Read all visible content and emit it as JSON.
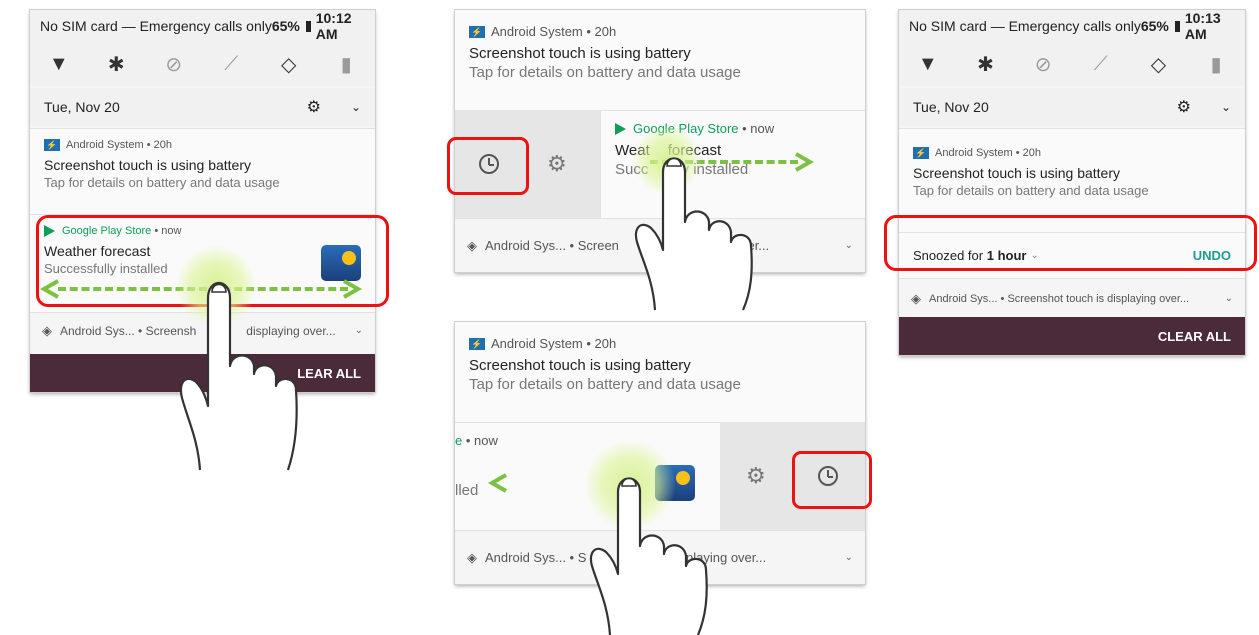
{
  "panel1": {
    "status": {
      "carrier": "No SIM card — Emergency calls only",
      "battery": "65%",
      "time": "10:12 AM"
    },
    "date": "Tue, Nov 20",
    "android_notif": {
      "app": "Android System",
      "age": "20h",
      "title": "Screenshot touch is using battery",
      "subtitle": "Tap for details on battery and data usage"
    },
    "play_notif": {
      "app": "Google Play Store",
      "age": "now",
      "title": "Weather forecast",
      "subtitle": "Successfully installed"
    },
    "collapsed": {
      "app": "Android Sys...",
      "text": "Screensh",
      "text2": "displaying over..."
    },
    "clear_all": "LEAR ALL"
  },
  "panel2": {
    "android_notif": {
      "app": "Android System",
      "age": "20h",
      "title": "Screenshot touch is using battery",
      "subtitle": "Tap for details on battery and data usage"
    },
    "play_notif": {
      "app": "Google Play Store",
      "age": "now",
      "title": "Weat",
      "title2": "forecast",
      "subtitle": "Succ",
      "subtitle2": "fully installed"
    },
    "collapsed": {
      "app": "Android Sys...",
      "text": "Screen",
      "text2": "playing over..."
    }
  },
  "panel3": {
    "android_notif": {
      "app": "Android System",
      "age": "20h",
      "title": "Screenshot touch is using battery",
      "subtitle": "Tap for details on battery and data usage"
    },
    "play_notif": {
      "app_frag": "e",
      "age": "now",
      "subtitle": "lled"
    },
    "collapsed": {
      "app": "Android Sys...",
      "text": "S",
      "text2": "is displaying over..."
    }
  },
  "panel4": {
    "status": {
      "carrier": "No SIM card — Emergency calls only",
      "battery": "65%",
      "time": "10:13 AM"
    },
    "date": "Tue, Nov 20",
    "android_notif": {
      "app": "Android System",
      "age": "20h",
      "title": "Screenshot touch is using battery",
      "subtitle": "Tap for details on battery and data usage"
    },
    "snooze": {
      "prefix": "Snoozed for",
      "duration": "1 hour",
      "undo": "UNDO"
    },
    "collapsed": {
      "app": "Android Sys...",
      "text": "Screenshot touch is displaying over..."
    },
    "clear_all": "CLEAR ALL"
  },
  "icons": [
    "wifi-icon",
    "bluetooth-icon",
    "dnd-icon",
    "flashlight-icon",
    "autorotate-icon",
    "battery-saver-icon",
    "settings-gear-icon",
    "chevron-down-icon",
    "snooze-clock-icon",
    "layers-icon"
  ],
  "colors": {
    "highlight": "#e11111",
    "swipe_arrow": "#7dc142",
    "play_green": "#0f9d58",
    "undo_teal": "#1a9e8f",
    "clear_bar": "#4b2a3a"
  }
}
